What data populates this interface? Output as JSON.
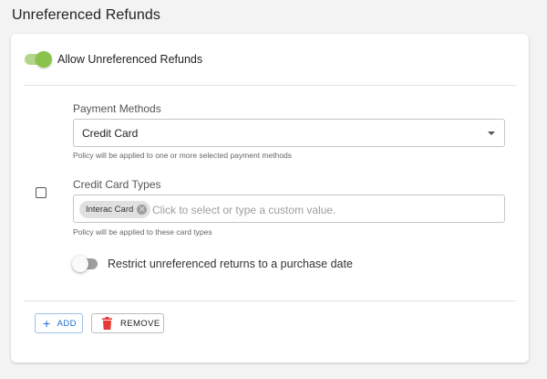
{
  "page": {
    "title": "Unreferenced Refunds"
  },
  "toggle": {
    "label": "Allow Unreferenced Refunds",
    "enabled": true
  },
  "payment_methods": {
    "label": "Payment Methods",
    "value": "Credit Card",
    "helper": "Policy will be applied to one or more selected payment methods"
  },
  "card_types": {
    "label": "Credit Card Types",
    "chips": [
      "Interac Card"
    ],
    "placeholder": "Click to select or type a custom value.",
    "helper": "Policy will be applied to these card types"
  },
  "restrict": {
    "label": "Restrict unreferenced returns to a purchase date",
    "enabled": false
  },
  "actions": {
    "add_label": "ADD",
    "remove_label": "REMOVE"
  },
  "icons": {
    "caret": "chevron-down-icon",
    "chip_close": "close-circle-icon",
    "add": "plus-icon",
    "remove": "trash-icon"
  },
  "colors": {
    "toggle_on": "#8bc34a",
    "accent": "#1e6fcf",
    "delete": "#e53935"
  }
}
